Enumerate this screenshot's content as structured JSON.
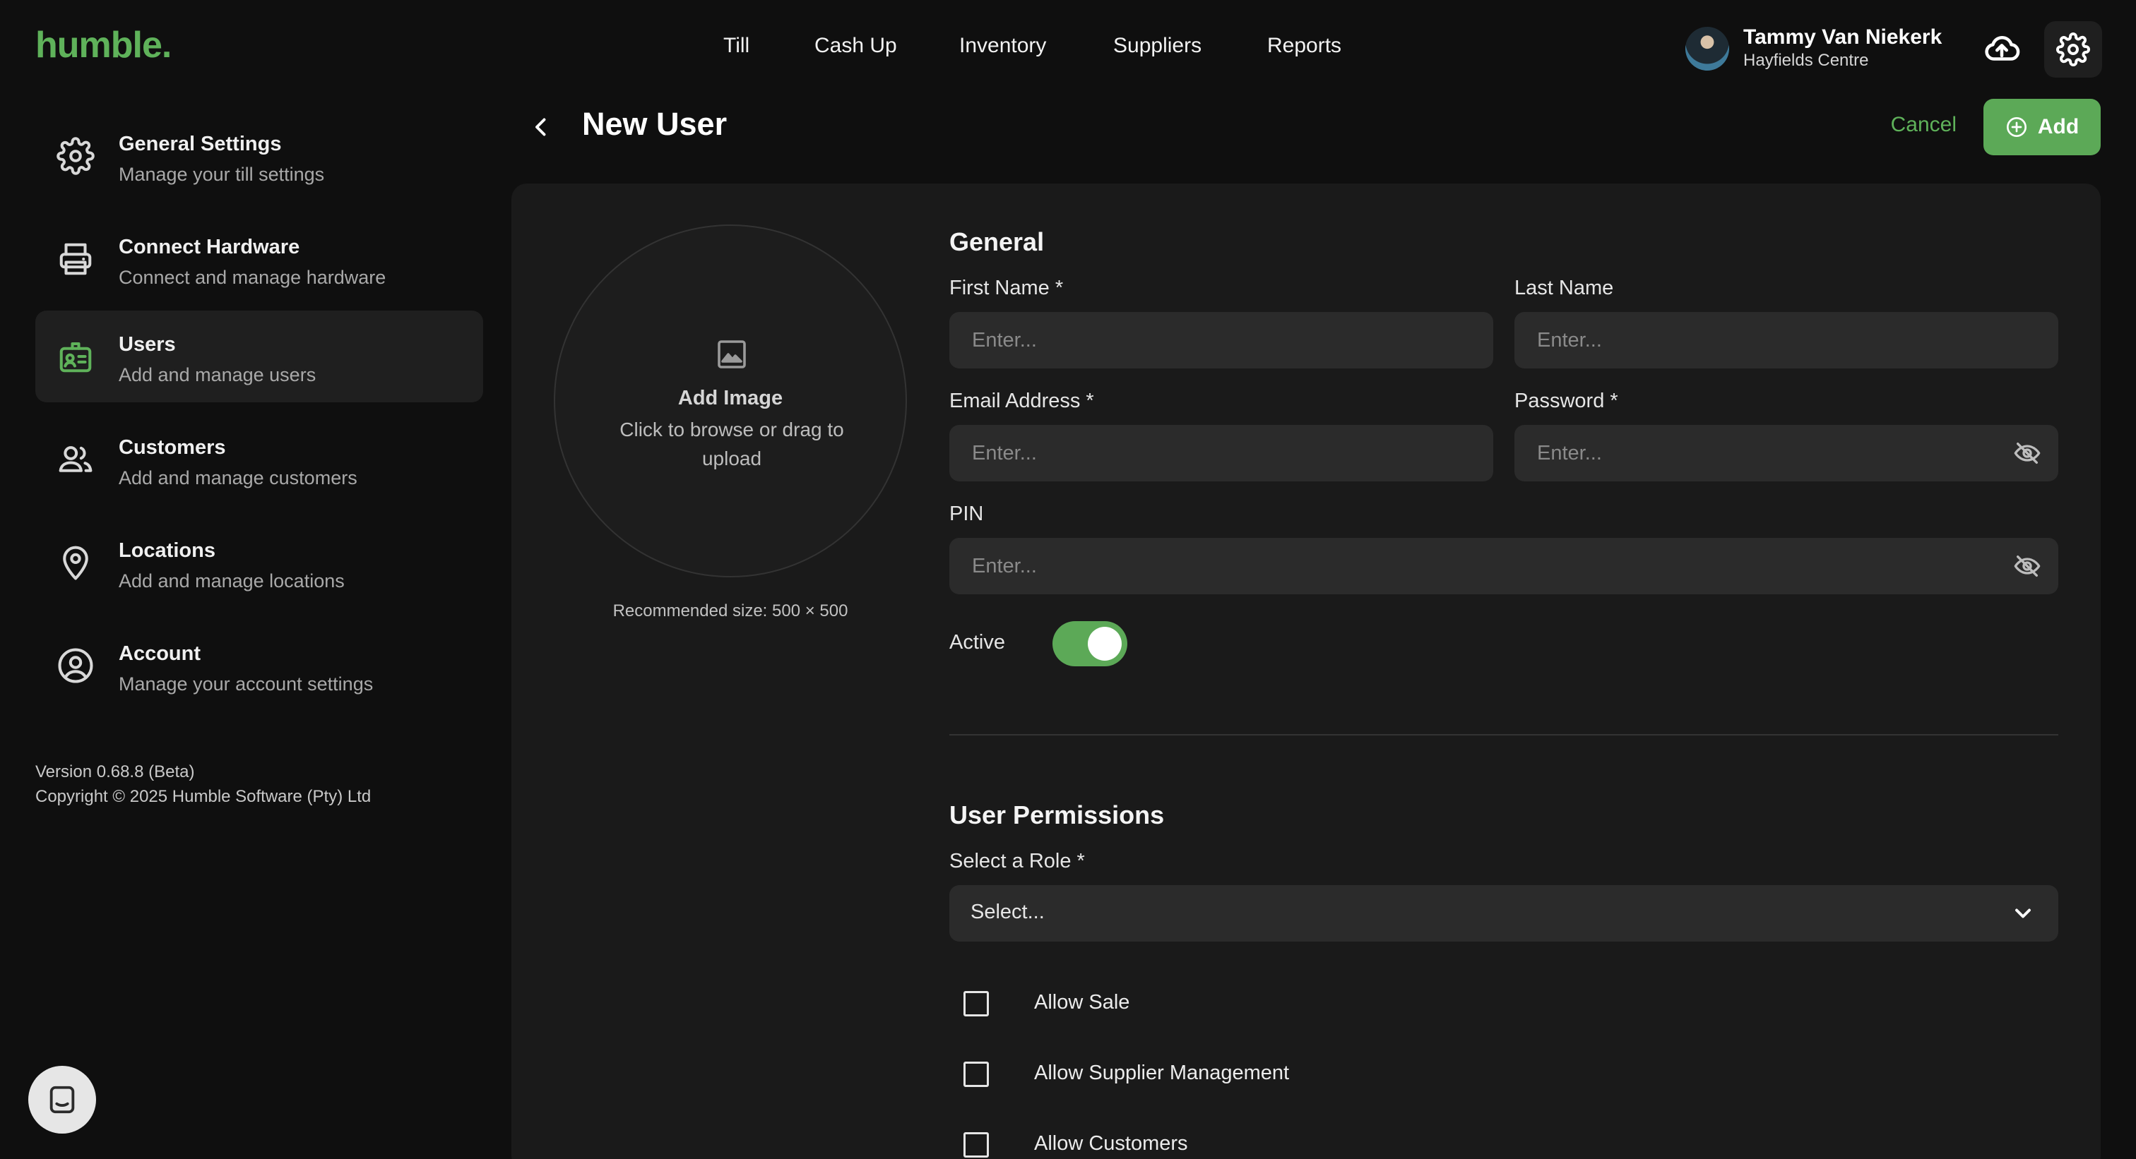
{
  "brand": {
    "logo": "humble.",
    "accent": "#5fb25a"
  },
  "nav": {
    "items": [
      "Till",
      "Cash Up",
      "Inventory",
      "Suppliers",
      "Reports"
    ]
  },
  "user": {
    "name": "Tammy Van Niekerk",
    "location": "Hayfields Centre"
  },
  "sidebar": {
    "items": [
      {
        "title": "General Settings",
        "subtitle": "Manage your till settings",
        "icon": "gear-icon"
      },
      {
        "title": "Connect Hardware",
        "subtitle": "Connect and manage hardware",
        "icon": "printer-icon"
      },
      {
        "title": "Users",
        "subtitle": "Add and manage users",
        "icon": "id-badge-icon",
        "active": true
      },
      {
        "title": "Customers",
        "subtitle": "Add and manage customers",
        "icon": "people-icon"
      },
      {
        "title": "Locations",
        "subtitle": "Add and manage locations",
        "icon": "location-pin-icon"
      },
      {
        "title": "Account",
        "subtitle": "Manage your account settings",
        "icon": "account-circle-icon"
      }
    ],
    "version": "Version 0.68.8 (Beta)",
    "copyright": "Copyright © 2025 Humble Software (Pty) Ltd"
  },
  "page": {
    "title": "New User",
    "cancel_label": "Cancel",
    "add_label": "Add"
  },
  "image_upload": {
    "title": "Add Image",
    "subtitle": "Click to browse or drag to upload",
    "recommended": "Recommended size: 500 × 500"
  },
  "general": {
    "heading": "General",
    "first_name": {
      "label": "First Name *",
      "placeholder": "Enter...",
      "value": ""
    },
    "last_name": {
      "label": "Last Name",
      "placeholder": "Enter...",
      "value": ""
    },
    "email": {
      "label": "Email Address *",
      "placeholder": "Enter...",
      "value": ""
    },
    "password": {
      "label": "Password *",
      "placeholder": "Enter...",
      "value": ""
    },
    "pin": {
      "label": "PIN",
      "placeholder": "Enter...",
      "value": ""
    },
    "active": {
      "label": "Active",
      "on": true
    }
  },
  "permissions": {
    "heading": "User Permissions",
    "role_label": "Select a Role *",
    "role_value": "Select...",
    "items": [
      {
        "label": "Allow Sale",
        "checked": false
      },
      {
        "label": "Allow Supplier Management",
        "checked": false
      },
      {
        "label": "Allow Customers",
        "checked": false
      }
    ]
  }
}
